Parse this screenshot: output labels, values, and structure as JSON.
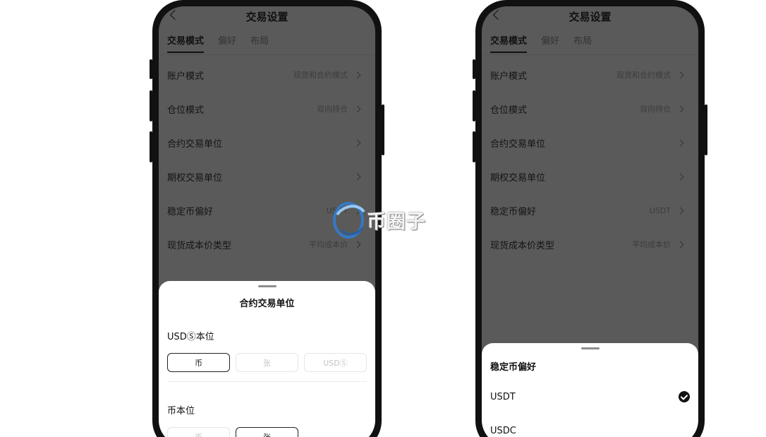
{
  "left_phone": {
    "header": {
      "title": "交易设置"
    },
    "tabs": [
      {
        "label": "交易模式",
        "active": true
      },
      {
        "label": "偏好",
        "active": false
      },
      {
        "label": "布局",
        "active": false
      }
    ],
    "settings": [
      {
        "label": "账户模式",
        "value": "现货和合约模式"
      },
      {
        "label": "仓位模式",
        "value": "双向持仓"
      },
      {
        "label": "合约交易单位",
        "value": ""
      },
      {
        "label": "期权交易单位",
        "value": ""
      },
      {
        "label": "稳定币偏好",
        "value": "USDT"
      },
      {
        "label": "现货成本价类型",
        "value": "平均成本价"
      }
    ],
    "sheet": {
      "title": "合约交易单位",
      "section1": {
        "label": "USDⓈ本位",
        "options": [
          {
            "label": "币",
            "selected": true
          },
          {
            "label": "张",
            "selected": false
          },
          {
            "label": "USDⓈ",
            "selected": false
          }
        ]
      },
      "section2": {
        "label": "币本位",
        "options": [
          {
            "label": "币",
            "selected": false
          },
          {
            "label": "张",
            "selected": true
          }
        ]
      }
    }
  },
  "right_phone": {
    "header": {
      "title": "交易设置"
    },
    "tabs": [
      {
        "label": "交易模式",
        "active": true
      },
      {
        "label": "偏好",
        "active": false
      },
      {
        "label": "布局",
        "active": false
      }
    ],
    "settings": [
      {
        "label": "账户模式",
        "value": "现货和合约模式"
      },
      {
        "label": "仓位模式",
        "value": "双向持仓"
      },
      {
        "label": "合约交易单位",
        "value": ""
      },
      {
        "label": "期权交易单位",
        "value": ""
      },
      {
        "label": "稳定币偏好",
        "value": "USDT"
      },
      {
        "label": "现货成本价类型",
        "value": "平均成本价"
      }
    ],
    "sheet": {
      "title": "稳定币偏好",
      "options": [
        {
          "label": "USDT",
          "selected": true
        },
        {
          "label": "USDC",
          "selected": false
        }
      ]
    }
  },
  "watermark": {
    "text": "币圈子"
  },
  "colors": {
    "overlay": "#5a5a5a",
    "sheet": "#ffffff",
    "accent": "#111111",
    "watermark_blue": "#2f7fd6"
  }
}
